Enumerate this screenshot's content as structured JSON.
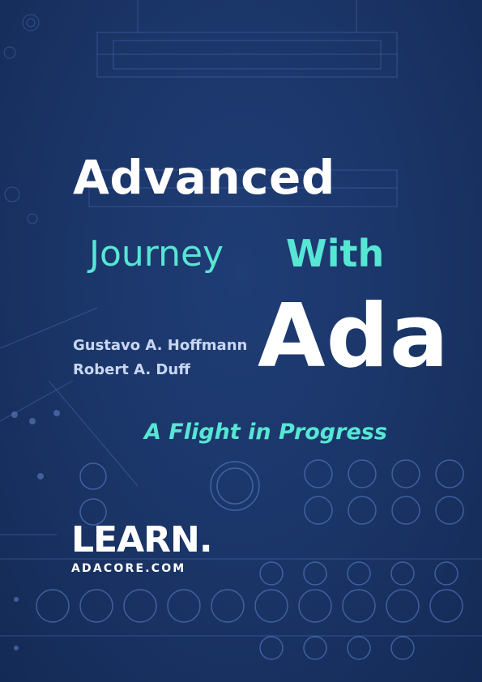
{
  "cover": {
    "title_line1": "Advanced",
    "title_journey": "Journey",
    "title_with": "With",
    "title_ada": "Ada",
    "authors": [
      "Gustavo A. Hoffmann",
      "Robert A. Duff"
    ],
    "subtitle": "A Flight in Progress",
    "logo": {
      "main": "LEARN.",
      "sub": "ADACORE.COM"
    }
  },
  "colors": {
    "background": "#1a3466",
    "accent": "#57e6d4",
    "title": "#ffffff",
    "authors": "#c9d6f0"
  }
}
